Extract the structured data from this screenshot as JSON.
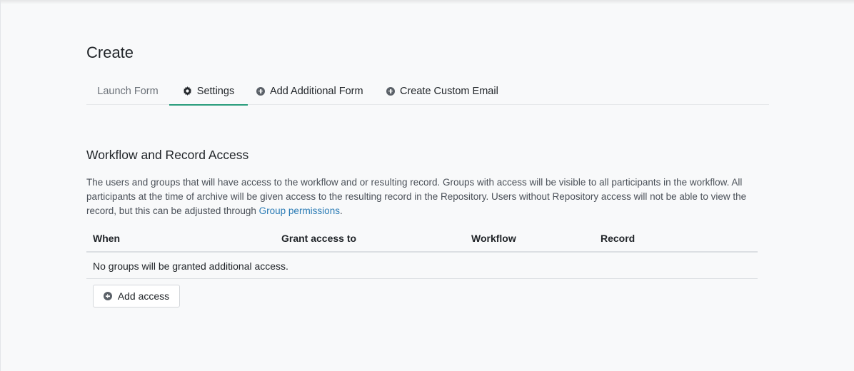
{
  "page": {
    "title": "Create"
  },
  "tabs": [
    {
      "label": "Launch Form",
      "icon": "",
      "active": false
    },
    {
      "label": "Settings",
      "icon": "gear-icon",
      "active": true
    },
    {
      "label": "Add Additional Form",
      "icon": "plus-circle-icon",
      "active": false
    },
    {
      "label": "Create Custom Email",
      "icon": "plus-circle-icon",
      "active": false
    }
  ],
  "section": {
    "title": "Workflow and Record Access",
    "description": "The users and groups that will have access to the workflow and or resulting record. Groups with access will be visible to all participants in the workflow. All participants at the time of archive will be given access to the resulting record in the Repository. Users without Repository access will not be able to view the record, but this can be adjusted through ",
    "link_text": "Group permissions",
    "description_end": "."
  },
  "table": {
    "columns": [
      "When",
      "Grant access to",
      "Workflow",
      "Record"
    ],
    "empty_message": "No groups will be granted additional access."
  },
  "add_access": {
    "label": "Add access"
  },
  "colors": {
    "accent": "#2a9d7c",
    "link": "#2a7bb5",
    "background": "#f8f9fa"
  }
}
